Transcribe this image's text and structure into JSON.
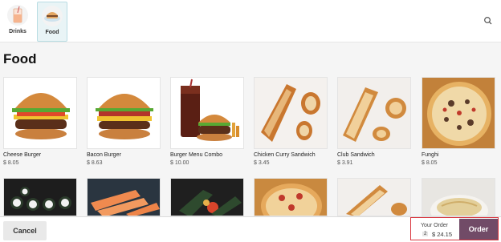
{
  "categories": [
    {
      "label": "Drinks",
      "icon": "drink-cup-icon",
      "active": false
    },
    {
      "label": "Food",
      "icon": "burger-icon",
      "active": true
    }
  ],
  "section_title": "Food",
  "products_row1": [
    {
      "name": "Cheese Burger",
      "price": "$ 8.05"
    },
    {
      "name": "Bacon Burger",
      "price": "$ 8.63"
    },
    {
      "name": "Burger Menu Combo",
      "price": "$ 10.00"
    },
    {
      "name": "Chicken Curry Sandwich",
      "price": "$ 3.45"
    },
    {
      "name": "Club Sandwich",
      "price": "$ 3.91"
    },
    {
      "name": "Funghi",
      "price": "$ 8.05"
    }
  ],
  "products_row2": [
    {
      "image": "sushi-rolls"
    },
    {
      "image": "salmon-sushi"
    },
    {
      "image": "seaweed-rolls"
    },
    {
      "image": "pizza"
    },
    {
      "image": "sandwich"
    },
    {
      "image": "noodles"
    }
  ],
  "footer": {
    "cancel_label": "Cancel",
    "your_order_label": "Your Order",
    "item_count": "2",
    "total": "$ 24.15",
    "order_label": "Order"
  },
  "colors": {
    "order_button": "#714b67",
    "highlight_border": "#d9363e",
    "active_category": "#e9f4f6"
  }
}
